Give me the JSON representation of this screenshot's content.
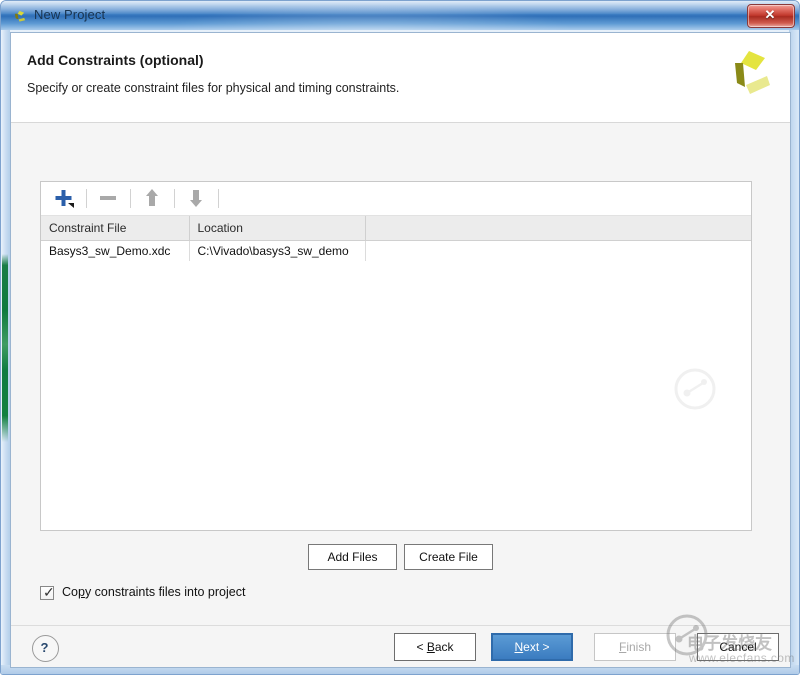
{
  "window": {
    "title": "New Project",
    "app_icon": "xilinx-vivado-icon",
    "close_label": "✕"
  },
  "header": {
    "title": "Add Constraints (optional)",
    "subtitle": "Specify or create constraint files for physical and timing constraints.",
    "logo": "xilinx-logo"
  },
  "toolbar": {
    "add_icon": "plus-icon",
    "remove_icon": "minus-icon",
    "move_up_icon": "arrow-up-icon",
    "move_down_icon": "arrow-down-icon",
    "accent_color": "#2b5faa",
    "disabled_color": "#a9a9a9"
  },
  "table": {
    "columns": [
      "Constraint File",
      "Location"
    ],
    "rows": [
      {
        "constraint_file": "Basys3_sw_Demo.xdc",
        "location": "C:\\Vivado\\basys3_sw_demo"
      }
    ]
  },
  "actions": {
    "add_files": "Add Files",
    "create_file": "Create File"
  },
  "options": {
    "copy_constraints": {
      "checked": true,
      "label_before": "Co",
      "label_mnemonic": "p",
      "label_after": "y constraints files into project",
      "full_label": "Copy constraints files into project"
    }
  },
  "footer": {
    "help": "?",
    "back": "< Back",
    "back_before": "< ",
    "back_mnemonic": "B",
    "back_after": "ack",
    "next": "Next >",
    "next_mnemonic": "N",
    "next_after": "ext >",
    "finish": "Finish",
    "finish_mnemonic": "F",
    "finish_after": "inish",
    "cancel": "Cancel",
    "next_enabled": true,
    "finish_enabled": false,
    "accent_color": "#3b7cc0"
  },
  "watermark": {
    "site": "www.elecfans.com",
    "brand": "电子发烧友"
  }
}
